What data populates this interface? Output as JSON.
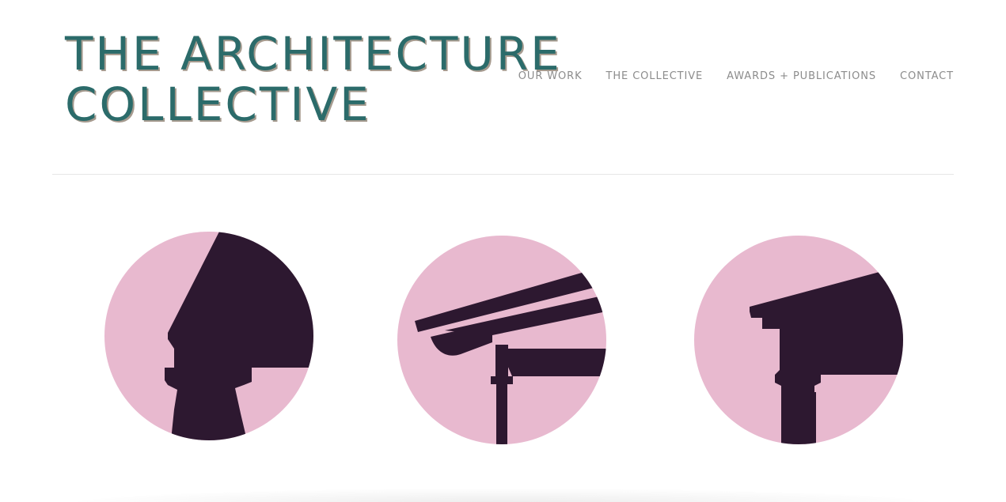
{
  "site": {
    "logo_line1": "THE ARCHITECTURE",
    "logo_line2": "COLLECTIVE"
  },
  "nav": {
    "items": [
      {
        "label": "OUR WORK"
      },
      {
        "label": "THE COLLECTIVE"
      },
      {
        "label": "AWARDS + PUBLICATIONS"
      },
      {
        "label": "CONTACT"
      }
    ]
  },
  "colors": {
    "logo_teal": "#2b6b6a",
    "logo_shadow": "#a59a8e",
    "circle_pink": "#e8b9cf",
    "silhouette_plum": "#2d1830",
    "nav_gray": "#8c8c8c"
  },
  "illustrations": [
    {
      "icon": "column-capital-silhouette-icon"
    },
    {
      "icon": "roof-gutter-silhouette-icon"
    },
    {
      "icon": "cornice-column-silhouette-icon"
    }
  ]
}
